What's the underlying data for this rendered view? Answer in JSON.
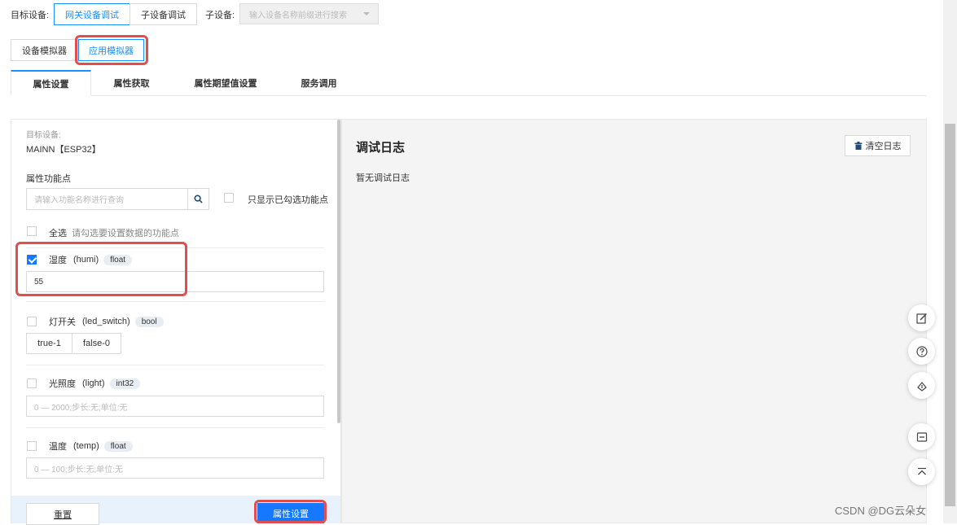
{
  "topbar": {
    "target_label": "目标设备:",
    "gateway_btn": "网关设备调试",
    "sub_btn": "子设备调试",
    "sub_label": "子设备:",
    "sub_select_placeholder": "输入设备名称前缀进行搜索"
  },
  "simulator_tabs": {
    "device": "设备模拟器",
    "app": "应用模拟器"
  },
  "tabs": [
    "属性设置",
    "属性获取",
    "属性期望值设置",
    "服务调用"
  ],
  "left": {
    "target_label": "目标设备:",
    "target_value": "MAINN【ESP32】",
    "func_label": "属性功能点",
    "search_placeholder": "请输入功能名称进行查询",
    "only_checked": "只显示已勾选功能点",
    "select_all": "全选",
    "select_all_hint": "请勾选要设置数据的功能点",
    "props": [
      {
        "name": "湿度",
        "id": "(humi)",
        "type": "float",
        "checked": true,
        "value": "55"
      },
      {
        "name": "灯开关",
        "id": "(led_switch)",
        "type": "bool",
        "checked": false,
        "opt1": "true-1",
        "opt2": "false-0"
      },
      {
        "name": "光照度",
        "id": "(light)",
        "type": "int32",
        "checked": false,
        "placeholder": "0 — 2000;步长:无;单位:无"
      },
      {
        "name": "温度",
        "id": "(temp)",
        "type": "float",
        "checked": false,
        "placeholder": "0 — 100;步长:无;单位:无"
      }
    ],
    "reset_btn": "重置",
    "submit_btn": "属性设置"
  },
  "right": {
    "title": "调试日志",
    "clear_btn": "清空日志",
    "empty": "暂无调试日志"
  },
  "floating_icons": [
    "edit-icon",
    "help-icon",
    "cloud-icon",
    "minus-icon",
    "back-to-top-icon"
  ],
  "watermark": "CSDN @DG云朵女"
}
